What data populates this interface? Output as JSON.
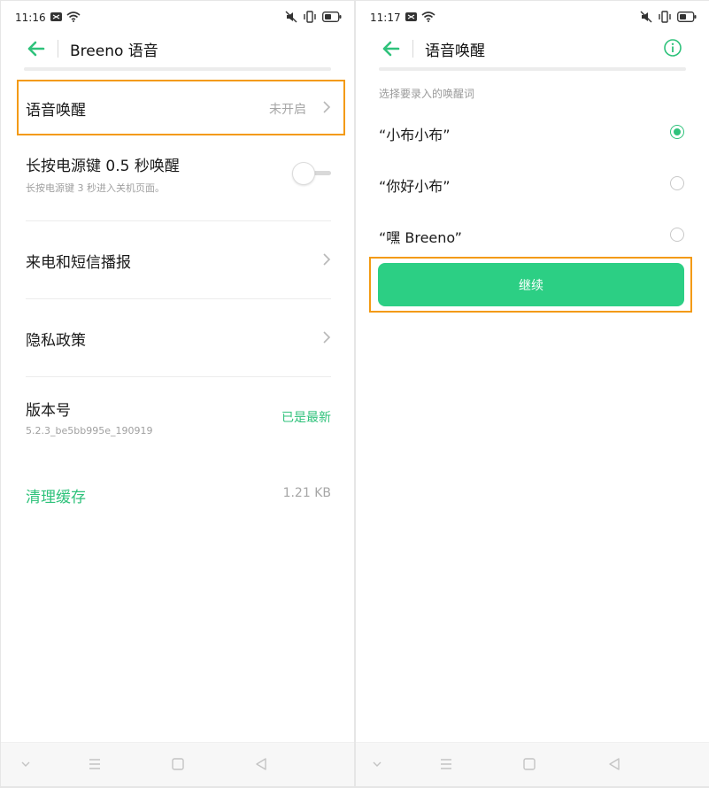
{
  "colors": {
    "accent": "#2fc27b",
    "button": "#2ccf84",
    "highlight": "#f39a12"
  },
  "left_screen": {
    "status": {
      "time": "11:16"
    },
    "header": {
      "title": "Breeno 语音"
    },
    "rows": {
      "voice_wake": {
        "title": "语音唤醒",
        "value": "未开启"
      },
      "power_key": {
        "title": "长按电源键 0.5 秒唤醒",
        "subtitle": "长按电源键 3 秒进入关机页面。",
        "toggle_on": false
      },
      "call_sms": {
        "title": "来电和短信播报"
      },
      "privacy": {
        "title": "隐私政策"
      },
      "version": {
        "title": "版本号",
        "subtitle": "5.2.3_be5bb995e_190919",
        "value": "已是最新"
      },
      "clear_cache": {
        "title": "清理缓存",
        "value": "1.21 KB"
      }
    }
  },
  "right_screen": {
    "status": {
      "time": "11:17"
    },
    "header": {
      "title": "语音唤醒"
    },
    "section_label": "选择要录入的唤醒词",
    "options": [
      {
        "label": "“小布小布”",
        "selected": true
      },
      {
        "label": "“你好小布”",
        "selected": false
      },
      {
        "label": "“嘿 Breeno”",
        "selected": false
      }
    ],
    "continue_label": "继续"
  },
  "icons": [
    "back-arrow-icon",
    "info-icon",
    "chevron-right-icon",
    "wifi-icon",
    "mute-icon",
    "vibrate-icon",
    "battery-icon",
    "nav-down-icon",
    "nav-menu-icon",
    "nav-home-icon",
    "nav-back-icon"
  ]
}
